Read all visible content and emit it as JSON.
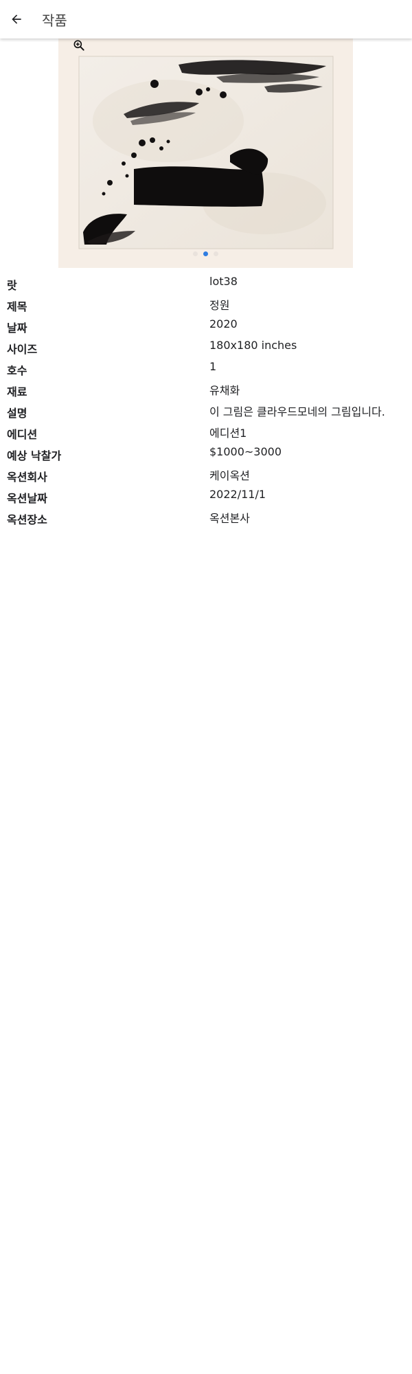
{
  "appbar": {
    "title": "작품",
    "back_icon": "arrow-left-icon"
  },
  "gallery": {
    "zoom_icon": "zoom-in-icon",
    "image_description": "abstract ink brushstroke painting",
    "slide_count": 3,
    "active_slide": 2,
    "active_dot_color": "#2f7de1",
    "inactive_dot_color": "#e9e2dc"
  },
  "details": [
    {
      "label": "랏",
      "value": "lot38"
    },
    {
      "label": "제목",
      "value": "정원"
    },
    {
      "label": "날짜",
      "value": "2020"
    },
    {
      "label": "사이즈",
      "value": "180x180 inches"
    },
    {
      "label": "호수",
      "value": "1"
    },
    {
      "label": "재료",
      "value": "유채화"
    },
    {
      "label": "설명",
      "value": "이 그림은 클라우드모네의 그림입니다."
    },
    {
      "label": "에디션",
      "value": "에디션1"
    },
    {
      "label": "예상 낙찰가",
      "value": "$1000~3000"
    },
    {
      "label": "옥션회사",
      "value": "케이옥션"
    },
    {
      "label": "옥션날짜",
      "value": "2022/11/1"
    },
    {
      "label": "옥션장소",
      "value": "옥션본사"
    }
  ]
}
